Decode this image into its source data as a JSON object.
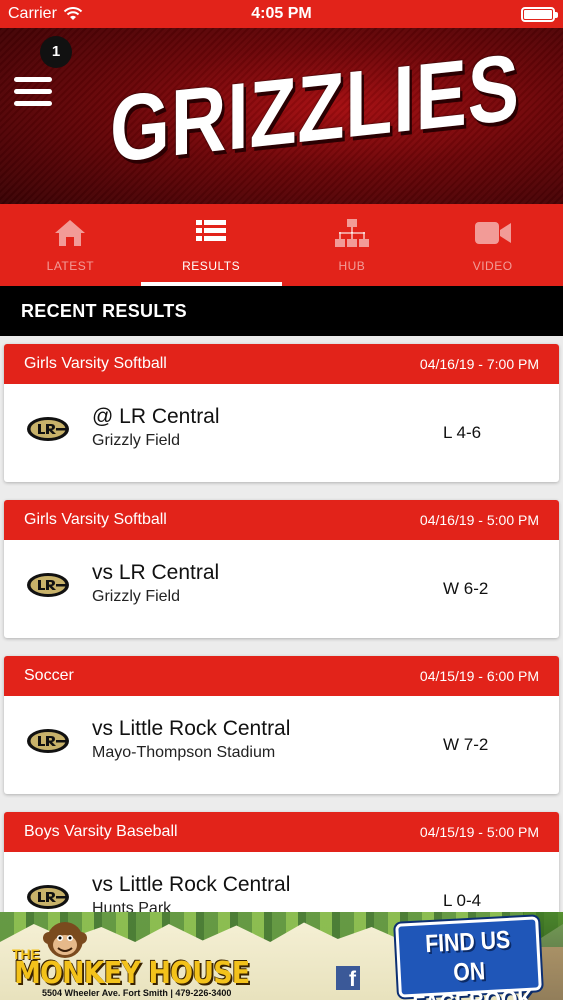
{
  "status_bar": {
    "carrier": "Carrier",
    "time": "4:05 PM"
  },
  "header": {
    "title": "GRIZZLIES",
    "notification_count": "1"
  },
  "tabs": [
    {
      "label": "LATEST",
      "icon": "home-icon",
      "active": false
    },
    {
      "label": "RESULTS",
      "icon": "list-icon",
      "active": true
    },
    {
      "label": "HUB",
      "icon": "sitemap-icon",
      "active": false
    },
    {
      "label": "VIDEO",
      "icon": "video-camera-icon",
      "active": false
    }
  ],
  "section": {
    "title": "RECENT RESULTS"
  },
  "results": [
    {
      "sport": "Girls Varsity Softball",
      "datetime": "04/16/19 - 7:00 PM",
      "opponent": "@ LR Central",
      "venue": "Grizzly Field",
      "score": "L 4-6"
    },
    {
      "sport": "Girls Varsity Softball",
      "datetime": "04/16/19 - 5:00 PM",
      "opponent": "vs LR Central",
      "venue": "Grizzly Field",
      "score": "W 6-2"
    },
    {
      "sport": "Soccer",
      "datetime": "04/15/19 - 6:00 PM",
      "opponent": "vs Little Rock Central",
      "venue": "Mayo-Thompson Stadium",
      "score": "W 7-2"
    },
    {
      "sport": "Boys Varsity Baseball",
      "datetime": "04/15/19 - 5:00 PM",
      "opponent": "vs Little Rock Central",
      "venue": "Hunts Park",
      "score": "L 0-4"
    }
  ],
  "ad": {
    "brand_prefix": "THE",
    "brand": "MONKEY HOUSE",
    "address": "5504 Wheeler Ave. Fort Smith | 479-226-3400",
    "cta_line1": "FIND US ON",
    "cta_line2": "FACEBOOK",
    "facebook_glyph": "f"
  },
  "colors": {
    "primary": "#e2231a",
    "header_dark": "#6b0508",
    "section_bg": "#000000",
    "logo_gold": "#c8b26a"
  }
}
